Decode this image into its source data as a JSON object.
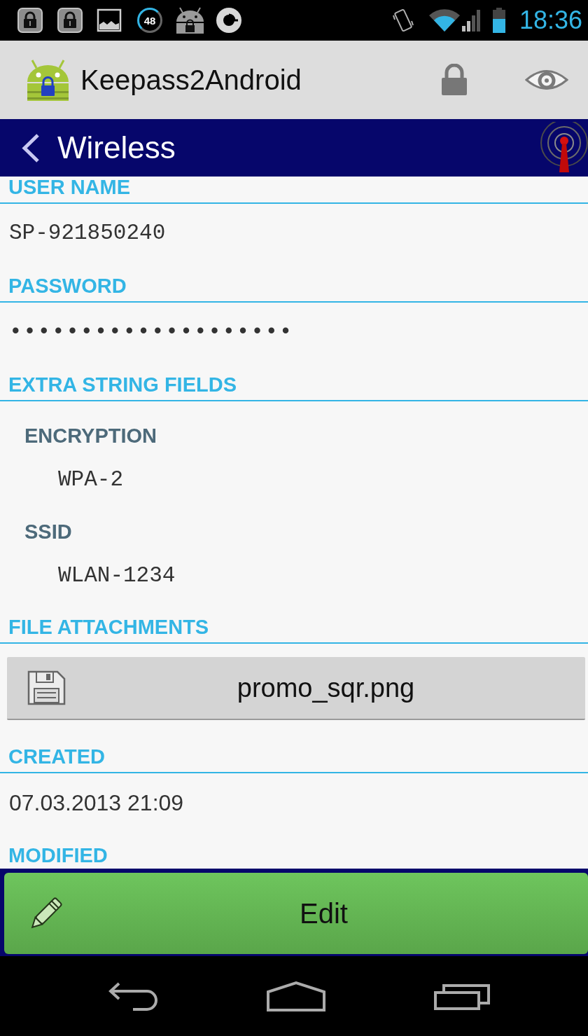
{
  "status_bar": {
    "notification_count": "48",
    "time": "18:36"
  },
  "app_bar": {
    "title": "Keepass2Android"
  },
  "entry_bar": {
    "title": "Wireless"
  },
  "sections": [
    {
      "kind": "text",
      "heading": "USER NAME",
      "value": "SP-921850240"
    },
    {
      "kind": "secret",
      "heading": "PASSWORD",
      "value": "••••••••••••••••••••"
    },
    {
      "kind": "group",
      "heading": "EXTRA STRING FIELDS",
      "fields": [
        {
          "label": "ENCRYPTION",
          "value": "WPA-2"
        },
        {
          "label": "SSID",
          "value": "WLAN-1234"
        }
      ]
    },
    {
      "kind": "attachments",
      "heading": "FILE ATTACHMENTS",
      "files": [
        "promo_sqr.png"
      ]
    },
    {
      "kind": "date",
      "heading": "CREATED",
      "value": "07.03.2013 21:09"
    },
    {
      "kind": "date",
      "heading": "MODIFIED"
    }
  ],
  "edit_button": {
    "label": "Edit"
  }
}
